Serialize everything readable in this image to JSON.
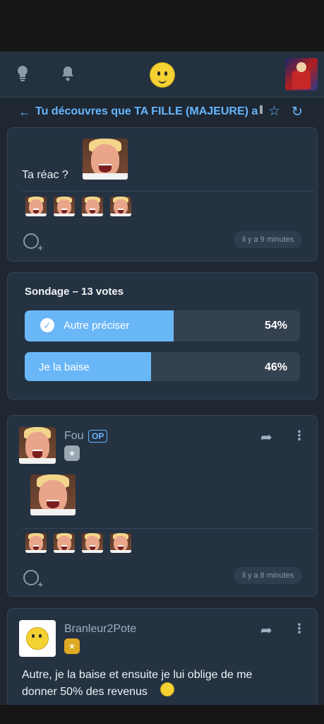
{
  "topic": {
    "title": "Tu découvres que TA FILLE (MAJEURE) a"
  },
  "first_post": {
    "text": "Ta réac ?",
    "time": "il y a 9 minutes"
  },
  "poll": {
    "title": "Sondage – 13 votes",
    "options": [
      {
        "label": "Autre préciser",
        "percent": "54%",
        "fraction": 0.54,
        "selected": true
      },
      {
        "label": "Je la baise",
        "percent": "46%",
        "fraction": 0.46,
        "selected": false
      }
    ]
  },
  "reply1": {
    "user": "Fou",
    "badge": "OP",
    "time": "il y a 8 minutes"
  },
  "reply2": {
    "user": "Branleur2Pote",
    "text": "Autre, je la baise et ensuite je lui oblige de me donner 50% des revenus"
  },
  "colors": {
    "accent": "#66b6ff",
    "poll_fill": "#6ab7f7"
  }
}
